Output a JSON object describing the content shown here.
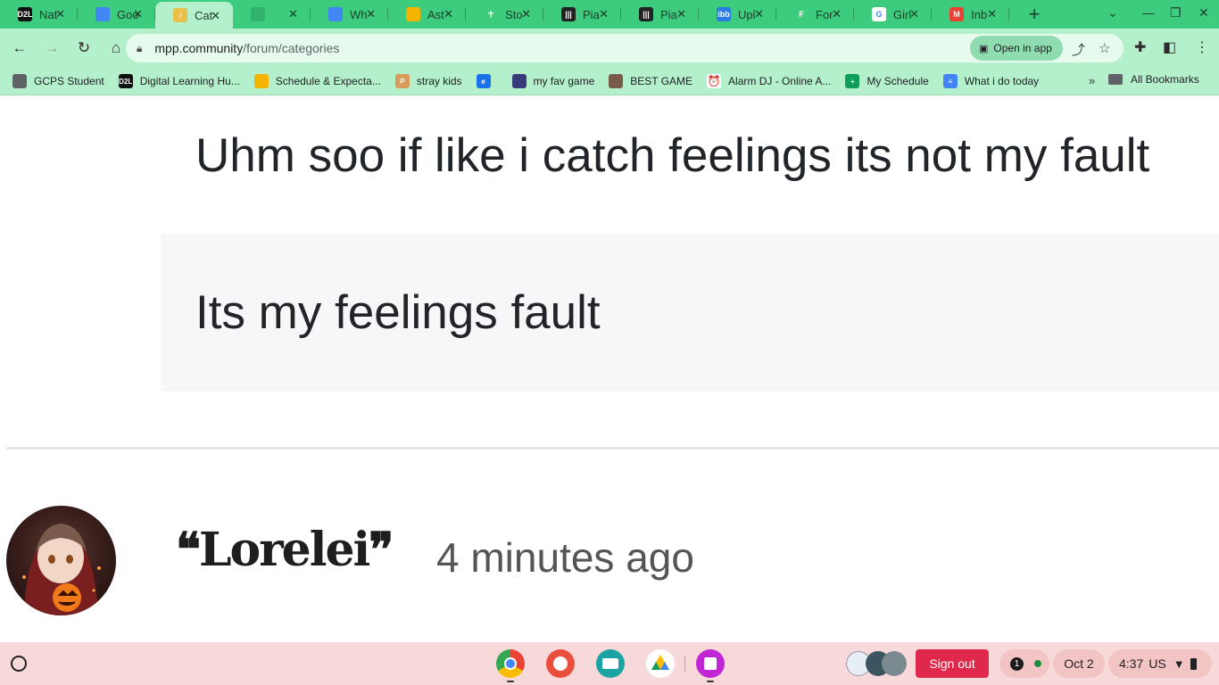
{
  "tabs": [
    {
      "title": "Nat",
      "favicon": "d2l-icon",
      "color": "#111111",
      "text": "D2L"
    },
    {
      "title": "Goo",
      "favicon": "google-docs-icon",
      "color": "#4285f4",
      "text": ""
    },
    {
      "title": "Cat",
      "favicon": "music-note-icon",
      "color": "#e8c04a",
      "text": "♪",
      "active": true
    },
    {
      "title": "",
      "favicon": "cube-icon",
      "color": "#2fb36d",
      "text": ""
    },
    {
      "title": "Wh",
      "favicon": "google-docs-icon",
      "color": "#4285f4",
      "text": ""
    },
    {
      "title": "Ast",
      "favicon": "google-slides-icon",
      "color": "#f4b400",
      "text": ""
    },
    {
      "title": "Sto",
      "favicon": "stick-figure-icon",
      "color": "#3dcc7d",
      "text": "☥"
    },
    {
      "title": "Pia",
      "favicon": "piano-icon",
      "color": "#222222",
      "text": "|||"
    },
    {
      "title": "Pia",
      "favicon": "piano-icon",
      "color": "#222222",
      "text": "|||"
    },
    {
      "title": "Upl",
      "favicon": "ibb-icon",
      "color": "#2a7de1",
      "text": "ibb"
    },
    {
      "title": "For",
      "favicon": "forum-icon",
      "color": "#3dcc7d",
      "text": "F"
    },
    {
      "title": "Girl",
      "favicon": "google-icon",
      "color": "#ffffff",
      "text": "G"
    },
    {
      "title": "Inb",
      "favicon": "gmail-icon",
      "color": "#ea4335",
      "text": "M"
    }
  ],
  "address": {
    "host": "mpp.community",
    "path": "/forum/categories",
    "open_in_app": "Open in app"
  },
  "bookmarks": [
    {
      "label": "GCPS Student",
      "icon": "classroom-icon",
      "color": "#5f6368",
      "text": ""
    },
    {
      "label": "Digital Learning Hu...",
      "icon": "d2l-icon",
      "color": "#111111",
      "text": "D2L"
    },
    {
      "label": "Schedule & Expecta...",
      "icon": "google-slides-icon",
      "color": "#f4b400",
      "text": ""
    },
    {
      "label": "stray kids",
      "icon": "pinterest-icon",
      "color": "#d99a5a",
      "text": "P"
    },
    {
      "label": "",
      "icon": "edge-icon",
      "color": "#1a73e8",
      "text": "e"
    },
    {
      "label": "my fav game",
      "icon": "game-icon",
      "color": "#3a3a7a",
      "text": ""
    },
    {
      "label": "BEST GAME",
      "icon": "game-face-icon",
      "color": "#7a5a4a",
      "text": ""
    },
    {
      "label": "Alarm DJ - Online A...",
      "icon": "alarm-clock-icon",
      "color": "#ffffff",
      "text": "⏰"
    },
    {
      "label": "My Schedule",
      "icon": "google-sheets-icon",
      "color": "#0f9d58",
      "text": "+"
    },
    {
      "label": "What i do today",
      "icon": "google-docs-icon",
      "color": "#4285f4",
      "text": "≡"
    }
  ],
  "all_bookmarks": "All Bookmarks",
  "post": {
    "line1": "Uhm soo if like i catch feelings its not my fault",
    "line2": "Its my feelings fault",
    "username": "❝Lorelei❞",
    "time_ago": "4 minutes ago"
  },
  "shelf": {
    "sign_out": "Sign out",
    "notification_count": "1",
    "date": "Oct 2",
    "time": "4:37",
    "locale": "US"
  }
}
